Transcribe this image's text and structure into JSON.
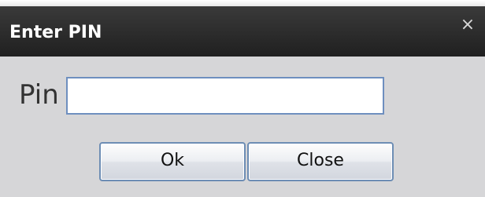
{
  "dialog": {
    "title": "Enter PIN",
    "close_glyph": "×",
    "pin_label": "Pin",
    "pin_input": {
      "value": "",
      "placeholder": ""
    },
    "buttons": {
      "ok_label": "Ok",
      "close_label": "Close"
    }
  },
  "colors": {
    "titlebar": "#2a2a2a",
    "body": "#d6d6d8",
    "input_border": "#6e8fbf",
    "button_border": "#6d8db4"
  }
}
